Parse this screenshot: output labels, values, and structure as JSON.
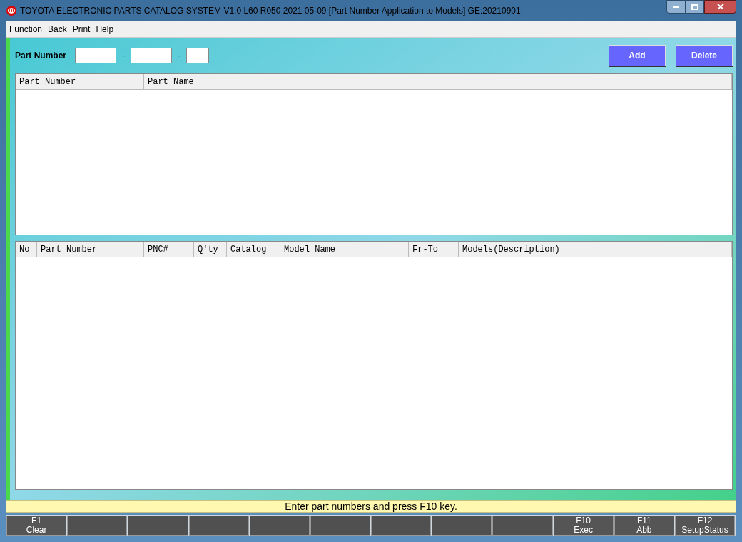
{
  "window": {
    "title": "TOYOTA ELECTRONIC PARTS CATALOG SYSTEM V1.0 L60 R050 2021 05-09 [Part Number Application to Models] GE:20210901"
  },
  "menu": [
    "Function",
    "Back",
    "Print",
    "Help"
  ],
  "part_number": {
    "label": "Part Number",
    "separators": [
      "-",
      "-"
    ]
  },
  "buttons": [
    "Add",
    "Delete"
  ],
  "parts_table": {
    "columns": [
      "Part Number",
      "Part Name"
    ]
  },
  "models_table": {
    "columns": [
      "No",
      "Part Number",
      "PNC#",
      "Q'ty",
      "Catalog",
      "Model Name",
      "Fr-To",
      "Models(Description)"
    ]
  },
  "status_bar": "Enter part numbers and press F10 key.",
  "function_keys": [
    {
      "kind": "key",
      "key": "F1",
      "label": "Clear"
    },
    {
      "kind": "blank"
    },
    {
      "kind": "blank"
    },
    {
      "kind": "blank"
    },
    {
      "kind": "blank"
    },
    {
      "kind": "blank"
    },
    {
      "kind": "blank"
    },
    {
      "kind": "blank"
    },
    {
      "kind": "blank"
    },
    {
      "kind": "key",
      "key": "F10",
      "label": "Exec"
    },
    {
      "kind": "key",
      "key": "F11",
      "label": "Abb"
    },
    {
      "kind": "key",
      "key": "F12",
      "label": "SetupStatus"
    }
  ]
}
